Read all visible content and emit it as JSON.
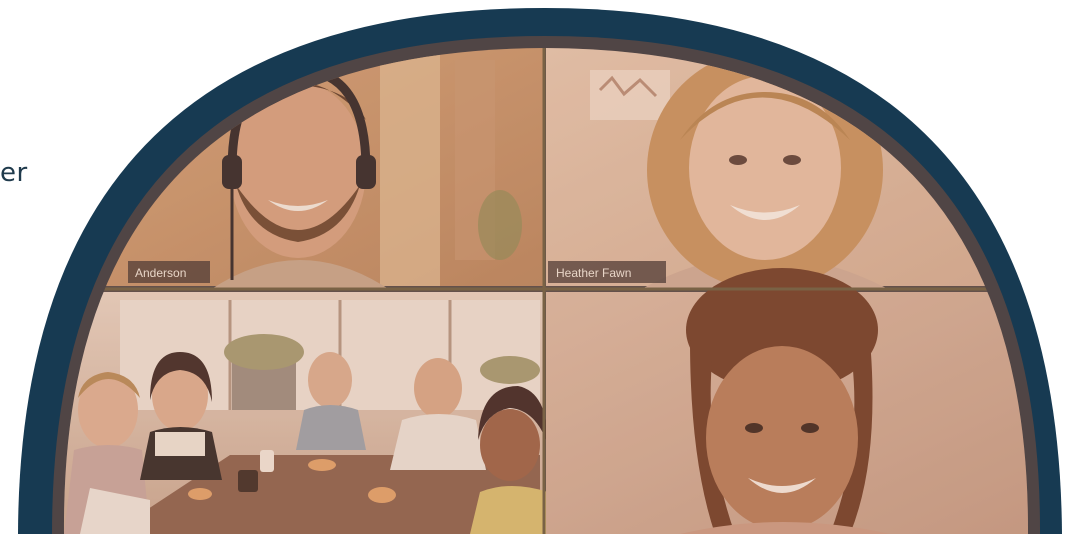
{
  "side_text": "er",
  "video_call": {
    "tiles": [
      {
        "label": "Anderson"
      },
      {
        "label": "Heather Fawn"
      }
    ]
  },
  "colors": {
    "frame_outer": "#173a52",
    "frame_inner": "#504545",
    "tint": "#c48a6a"
  }
}
